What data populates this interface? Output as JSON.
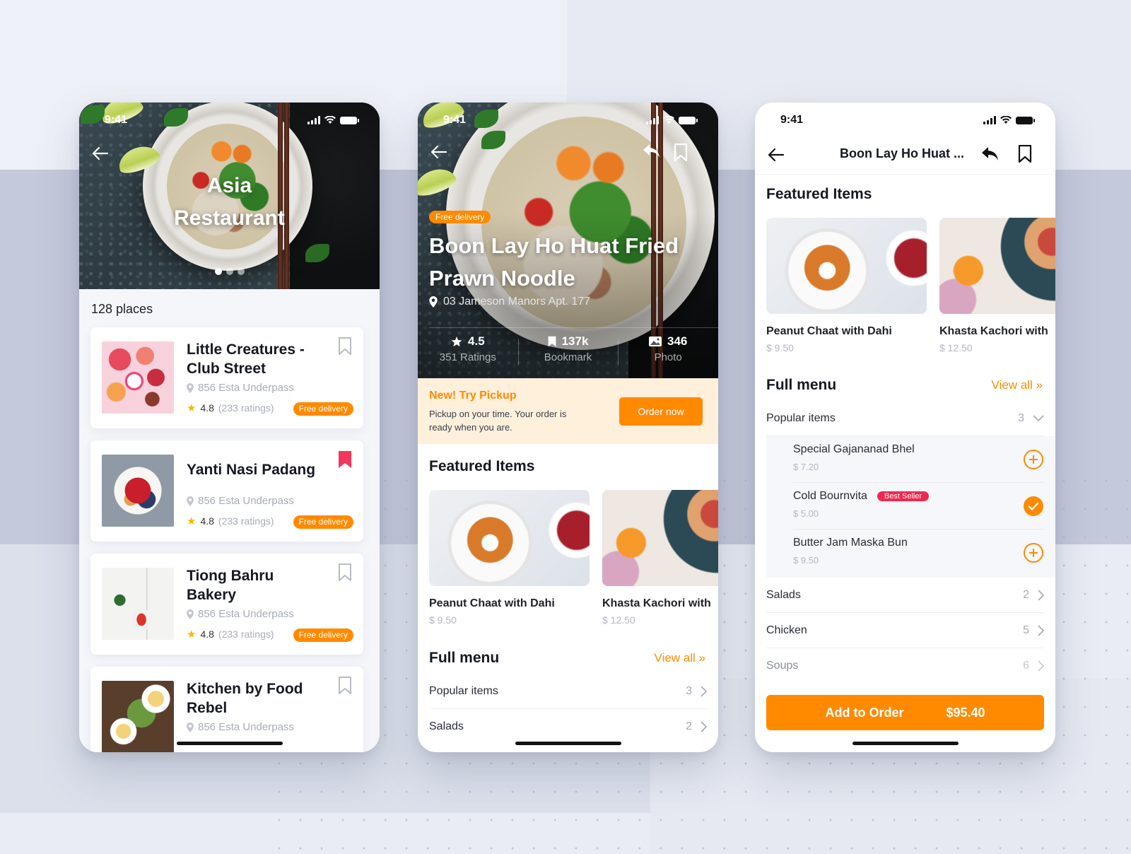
{
  "colors": {
    "accent": "#ff8a00",
    "bookmark_active": "#f4365c",
    "best_seller": "#f0284f",
    "pickup_bg": "#fff0dc"
  },
  "status_bar": {
    "time": "9:41"
  },
  "screen1": {
    "hero_title_line1": "Asia",
    "hero_title_line2": "Restaurant",
    "carousel": {
      "pages": 3,
      "active": 1
    },
    "places_count": "128 places",
    "restaurants": [
      {
        "name": "Little Creatures - Club Street",
        "address": "856 Esta Underpass",
        "rating": "4.8",
        "ratings_count": "(233 ratings)",
        "badge": "Free delivery",
        "bookmarked": false,
        "icon": "bookmark-icon"
      },
      {
        "name": "Yanti Nasi Padang",
        "address": "856 Esta Underpass",
        "rating": "4.8",
        "ratings_count": "(233 ratings)",
        "badge": "Free delivery",
        "bookmarked": true,
        "icon": "bookmark-filled-icon"
      },
      {
        "name": "Tiong Bahru Bakery",
        "address": "856 Esta Underpass",
        "rating": "4.8",
        "ratings_count": "(233 ratings)",
        "badge": "Free delivery",
        "bookmarked": false,
        "icon": "bookmark-icon"
      },
      {
        "name": "Kitchen by Food Rebel",
        "address": "856 Esta Underpass",
        "bookmarked": false,
        "icon": "bookmark-icon"
      }
    ]
  },
  "screen2": {
    "badge": "Free delivery",
    "restaurant_name": "Boon Lay Ho Huat Fried Prawn Noodle",
    "address": "03 Jameson Manors Apt. 177",
    "stats": [
      {
        "icon": "star-icon",
        "value": "4.5",
        "label": "351 Ratings"
      },
      {
        "icon": "bookmark-icon",
        "value": "137k",
        "label": "Bookmark"
      },
      {
        "icon": "photo-icon",
        "value": "346",
        "label": "Photo"
      }
    ],
    "pickup": {
      "title": "New! Try Pickup",
      "description": "Pickup on your time. Your order is ready when you are.",
      "button": "Order now"
    },
    "featured_title": "Featured Items",
    "featured": [
      {
        "name": "Peanut Chaat with Dahi",
        "price": "$ 9.50"
      },
      {
        "name": "Khasta Kachori with",
        "price": "$ 12.50"
      }
    ],
    "full_menu_title": "Full menu",
    "view_all": "View all »",
    "menu": [
      {
        "name": "Popular items",
        "count": "3"
      },
      {
        "name": "Salads",
        "count": "2"
      }
    ]
  },
  "screen3": {
    "nav_title": "Boon Lay Ho Huat ...",
    "featured_title": "Featured Items",
    "featured": [
      {
        "name": "Peanut Chaat with Dahi",
        "price": "$ 9.50"
      },
      {
        "name": "Khasta Kachori with",
        "price": "$ 12.50"
      }
    ],
    "full_menu_title": "Full menu",
    "view_all": "View all »",
    "popular": {
      "name": "Popular items",
      "count": "3",
      "expanded": true
    },
    "popular_items": [
      {
        "name": "Special Gajananad Bhel",
        "price": "$ 7.20",
        "badge": "",
        "added": false
      },
      {
        "name": "Cold Bournvita",
        "price": "$ 5.00",
        "badge": "Best Seller",
        "added": true
      },
      {
        "name": "Butter Jam Maska Bun",
        "price": "$ 9.50",
        "badge": "",
        "added": false
      }
    ],
    "menu": [
      {
        "name": "Salads",
        "count": "2"
      },
      {
        "name": "Chicken",
        "count": "5"
      },
      {
        "name": "Soups",
        "count": "6"
      }
    ],
    "add_to_order": {
      "label": "Add to Order",
      "total": "$95.40"
    }
  }
}
